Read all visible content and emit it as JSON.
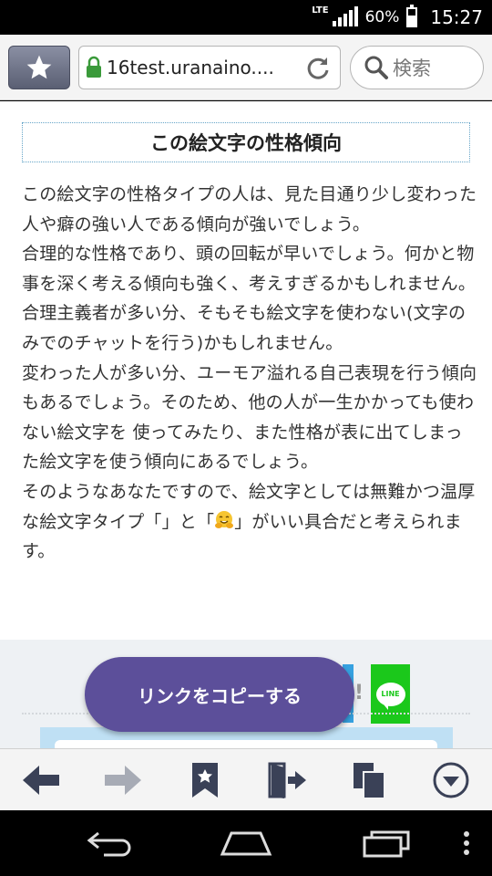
{
  "status_bar": {
    "network": "LTE",
    "battery": "60%",
    "battery_level": 0.6,
    "time": "15:27"
  },
  "toolbar": {
    "bookmark_icon": "star-icon",
    "url": "16test.uranaino....",
    "search_label": "検索"
  },
  "article": {
    "section_title": "この絵文字の性格傾向",
    "paragraphs": [
      "この絵文字の性格タイプの人は、見た目通り少し変わった人や癖の強い人である傾向が強いでしょう。",
      "合理的な性格であり、頭の回転が早いでしょう。何かと物事を深く考える傾向も強く、考えすぎるかもしれません。 合理主義者が多い分、そもそも絵文字を使わない(文字のみでのチャットを行う)かもしれません。",
      "変わった人が多い分、ユーモア溢れる自己表現を行う傾向もあるでしょう。そのため、他の人が一生かかっても使わない絵文字を 使ってみたり、また性格が表に出てしまった絵文字を使う傾向にあるでしょう。"
    ],
    "last_para_part1": "そのようなあなたですので、絵文字としては無難かつ温厚な絵文字タイプ「",
    "last_para_part2": "」と「",
    "last_para_part3": "」がいい具合だと考えられます。",
    "emoji_icon": "hugging-face-emoji"
  },
  "share": {
    "copy_link_label": "リンクをコピーする",
    "line_label": "LINE",
    "exclamation": "!"
  },
  "bottom_bar": {
    "items": [
      "back-arrow-icon",
      "forward-arrow-icon",
      "bookmark-icon",
      "exit-door-icon",
      "tabs-icon",
      "menu-down-icon"
    ]
  },
  "nav_bar": {
    "items": [
      "nav-back-icon",
      "nav-home-icon",
      "nav-recents-icon",
      "nav-overflow-icon"
    ]
  },
  "colors": {
    "copy_button": "#5c4f9a",
    "line_green": "#1bc81b",
    "title_border": "#67a6c9"
  }
}
